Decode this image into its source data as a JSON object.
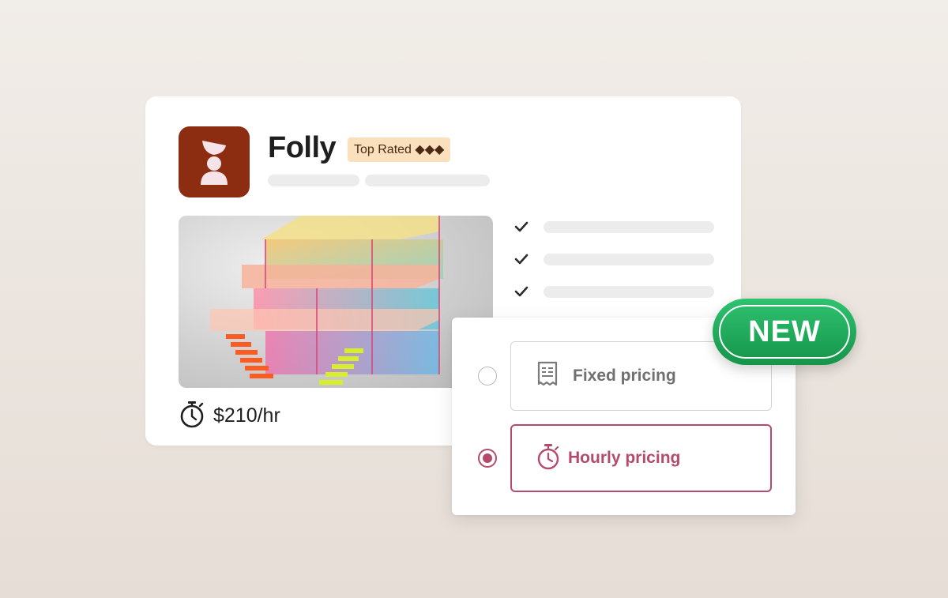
{
  "profile": {
    "name": "Folly",
    "badge": "Top Rated ◆◆◆",
    "price": "$210/hr"
  },
  "pricing_options": [
    {
      "label": "Fixed pricing",
      "icon": "receipt-icon",
      "selected": false
    },
    {
      "label": "Hourly pricing",
      "icon": "stopwatch-icon",
      "selected": true
    }
  ],
  "new_badge": "NEW",
  "colors": {
    "accent": "#b54b6c",
    "logo_bg": "#8c2c10",
    "badge_bg": "#fbe0bd",
    "new_green": "#1fa85a"
  }
}
